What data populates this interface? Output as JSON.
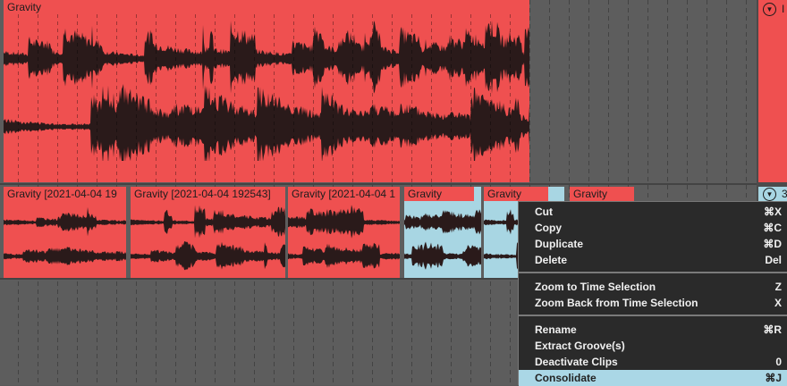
{
  "colors": {
    "clip_red": "#ef5050",
    "clip_blue": "#a8d6e3",
    "waveform": "#2a1a1a",
    "menu_bg": "#2a2a2a",
    "menu_selected": "#aad7e6"
  },
  "tracks": [
    {
      "clips": [
        {
          "title": "Gravity",
          "color": "red",
          "selected": false
        }
      ]
    },
    {
      "clips": [
        {
          "title": "Gravity [2021-04-04 19",
          "color": "red",
          "selected": false
        },
        {
          "title": "Gravity [2021-04-04 192543]",
          "color": "red",
          "selected": false
        },
        {
          "title": "Gravity [2021-04-04 1",
          "color": "red",
          "selected": false
        },
        {
          "title": "Gravity",
          "color": "blue",
          "selected": true
        },
        {
          "title": "Gravity",
          "color": "blue",
          "selected": true
        },
        {
          "title": "Gravity",
          "color": "blue",
          "selected": true
        }
      ]
    }
  ],
  "right_panel": {
    "track1": {
      "icon": "chevron-down-icon",
      "name": "I"
    },
    "track2": {
      "icon": "chevron-down-icon",
      "name": "3"
    }
  },
  "context_menu": {
    "groups": [
      [
        {
          "label": "Cut",
          "shortcut": "⌘X"
        },
        {
          "label": "Copy",
          "shortcut": "⌘C"
        },
        {
          "label": "Duplicate",
          "shortcut": "⌘D"
        },
        {
          "label": "Delete",
          "shortcut": "Del"
        }
      ],
      [
        {
          "label": "Zoom to Time Selection",
          "shortcut": "Z"
        },
        {
          "label": "Zoom Back from Time Selection",
          "shortcut": "X"
        }
      ],
      [
        {
          "label": "Rename",
          "shortcut": "⌘R"
        },
        {
          "label": "Extract Groove(s)",
          "shortcut": ""
        },
        {
          "label": "Deactivate Clips",
          "shortcut": "0"
        },
        {
          "label": "Consolidate",
          "shortcut": "⌘J",
          "highlighted": true
        }
      ]
    ]
  }
}
